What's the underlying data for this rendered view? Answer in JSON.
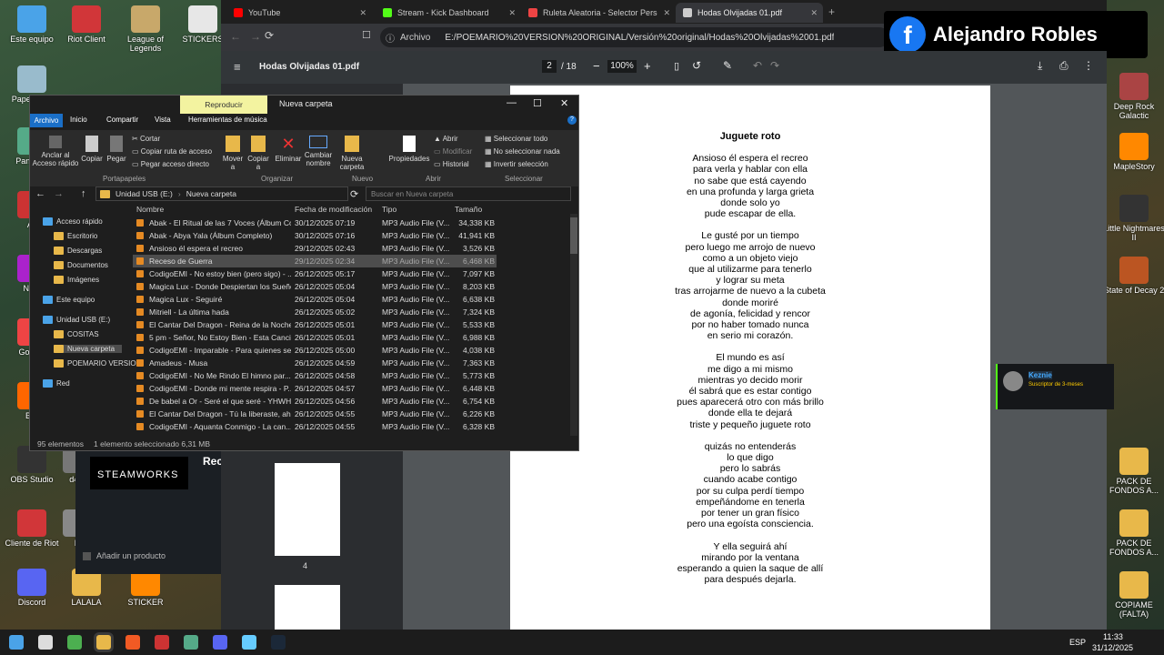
{
  "desktop": {
    "left_icons": [
      {
        "label": "Este equipo",
        "color": "#4aa3e8"
      },
      {
        "label": "Riot Client",
        "color": "#d13639"
      },
      {
        "label": "League of Legends",
        "color": "#c8a86a"
      },
      {
        "label": "STICKERS",
        "color": "#e7e7e7"
      },
      {
        "label": "Papel recic",
        "color": "#9bc"
      },
      {
        "label": "Panel de",
        "color": "#5a8"
      },
      {
        "label": "Av",
        "color": "#c33"
      },
      {
        "label": "Nitro",
        "color": "#a2c"
      },
      {
        "label": "Google",
        "color": "#e44"
      },
      {
        "label": "Bra",
        "color": "#f60"
      },
      {
        "label": "OBS Studio",
        "color": "#333"
      },
      {
        "label": "d4f0",
        "color": "#777"
      },
      {
        "label": "Cliente de Riot",
        "color": "#d13639"
      },
      {
        "label": "R",
        "color": "#888"
      },
      {
        "label": "Discord",
        "color": "#5865f2"
      },
      {
        "label": "LALALA",
        "color": "#e8b84a"
      },
      {
        "label": "STICKER",
        "color": "#f80"
      }
    ],
    "right_icons": [
      {
        "label": "Deep Rock Galactic",
        "color": "#a44"
      },
      {
        "label": "MapleStory",
        "color": "#f80"
      },
      {
        "label": "Little Nightmares II",
        "color": "#333"
      },
      {
        "label": "State of Decay 2",
        "color": "#b52"
      },
      {
        "label": "PACK DE FONDOS A...",
        "color": "#e8b84a"
      },
      {
        "label": "PACK DE FONDOS A...",
        "color": "#e8b84a"
      },
      {
        "label": "COPIAME (FALTA)",
        "color": "#e8b84a"
      }
    ],
    "overlay_name": "Alejandro Robles",
    "steamworks": "STEAMWORKS",
    "rec": "Rec",
    "add_product": "Añadir un producto",
    "chat": {
      "user": "Keznie",
      "badge": "Suscriptor de 3-meses"
    }
  },
  "browser": {
    "tabs": [
      {
        "label": "YouTube",
        "color": "#f00"
      },
      {
        "label": "Stream - Kick Dashboard",
        "color": "#53fc18"
      },
      {
        "label": "Ruleta Aleatoria - Selector Personaliz",
        "color": "#e44"
      },
      {
        "label": "Hodas Olvijadas 01.pdf",
        "color": "#ccc"
      }
    ],
    "address_prefix": "Archivo",
    "url": "E:/POEMARIO%20VERSION%20ORIGINAL/Versión%20original/Hodas%20Olvijadas%2001.pdf"
  },
  "pdf": {
    "title": "Hodas Olvijadas 01.pdf",
    "page_current": "2",
    "page_total": "/ 18",
    "zoom": "100%",
    "thumb_label": "4",
    "poem_title": "Juguete roto",
    "stanzas": [
      [
        "Ansioso él espera el recreo",
        "para verla y hablar con ella",
        "no sabe que está cayendo",
        "en una profunda y larga grieta",
        "donde solo yo",
        "pude escapar de ella."
      ],
      [
        "Le gusté por un tiempo",
        "pero luego me arrojo de nuevo",
        "como a un objeto viejo",
        "que al utilizarme para tenerlo",
        "y lograr su meta",
        "tras arrojarme de nuevo a la cubeta",
        "donde moriré",
        "de agonía, felicidad y rencor",
        "por no haber tomado nunca",
        "en serio mi corazón."
      ],
      [
        "El mundo es así",
        "me digo a mi mismo",
        "mientras yo decido morir",
        "él sabrá que es estar contigo",
        "pues aparecerá otro con más brillo",
        "donde ella te dejará",
        "triste y pequeño juguete roto"
      ],
      [
        "quizás no entenderás",
        "lo que digo",
        "pero lo sabrás",
        "cuando acabe contigo",
        "por su culpa perdí tiempo",
        "empeñándome en tenerla",
        "por tener un gran físico",
        "pero una egoísta consciencia."
      ],
      [
        "Y ella seguirá ahí",
        "mirando por la ventana",
        "esperando a quien la saque de allí",
        "para después dejarla."
      ]
    ]
  },
  "explorer": {
    "context_tab": "Reproducir",
    "window_title": "Nueva carpeta",
    "menu": [
      "Archivo",
      "Inicio",
      "Compartir",
      "Vista",
      "Herramientas de música"
    ],
    "ribbon": {
      "pin": "Anclar al Acceso rápido",
      "copy": "Copiar",
      "paste": "Pegar",
      "cut": "Cortar",
      "copy_path": "Copiar ruta de acceso",
      "paste_shortcut": "Pegar acceso directo",
      "move": "Mover a",
      "copy_to": "Copiar a",
      "delete": "Eliminar",
      "rename": "Cambiar nombre",
      "new_folder": "Nueva carpeta",
      "properties": "Propiedades",
      "open": "Abrir",
      "modify": "Modificar",
      "history": "Historial",
      "select_all": "Seleccionar todo",
      "select_none": "No seleccionar nada",
      "invert": "Invertir selección",
      "groups": [
        "Portapapeles",
        "Organizar",
        "Nuevo",
        "Abrir",
        "Seleccionar"
      ]
    },
    "path": [
      "Unidad USB (E:)",
      "Nueva carpeta"
    ],
    "search_placeholder": "Buscar en Nueva carpeta",
    "nav": [
      {
        "label": "Acceso rápido",
        "indent": 0
      },
      {
        "label": "Escritorio",
        "indent": 1
      },
      {
        "label": "Descargas",
        "indent": 1
      },
      {
        "label": "Documentos",
        "indent": 1
      },
      {
        "label": "Imágenes",
        "indent": 1
      },
      {
        "label": "Este equipo",
        "indent": 0
      },
      {
        "label": "Unidad USB (E:)",
        "indent": 0
      },
      {
        "label": "COSITAS",
        "indent": 1
      },
      {
        "label": "Nueva carpeta",
        "indent": 1
      },
      {
        "label": "POEMARIO VERSIO",
        "indent": 1
      },
      {
        "label": "Red",
        "indent": 0
      }
    ],
    "columns": [
      "Nombre",
      "Fecha de modificación",
      "Tipo",
      "Tamaño"
    ],
    "files": [
      [
        "Abak - El Ritual de las 7 Voces (Álbum Co...",
        "30/12/2025 07:19",
        "MP3 Audio File (V...",
        "34,338 KB"
      ],
      [
        "Abak - Abya Yala (Álbum Completo)",
        "30/12/2025 07:16",
        "MP3 Audio File (V...",
        "41,941 KB"
      ],
      [
        "Ansioso él espera el recreo",
        "29/12/2025 02:43",
        "MP3 Audio File (V...",
        "3,526 KB"
      ],
      [
        "Receso de Guerra",
        "29/12/2025 02:34",
        "MP3 Audio File (V...",
        "6,468 KB"
      ],
      [
        "CodigoEMI - No estoy bien (pero sigo) - ...",
        "26/12/2025 05:17",
        "MP3 Audio File (V...",
        "7,097 KB"
      ],
      [
        "Magica Lux - Donde Despiertan los Sueños",
        "26/12/2025 05:04",
        "MP3 Audio File (V...",
        "8,203 KB"
      ],
      [
        "Magica Lux - Seguiré",
        "26/12/2025 05:04",
        "MP3 Audio File (V...",
        "6,638 KB"
      ],
      [
        "Mitriell - La última hada",
        "26/12/2025 05:02",
        "MP3 Audio File (V...",
        "7,324 KB"
      ],
      [
        "El Cantar Del Dragon - Reina de la Noche...",
        "26/12/2025 05:01",
        "MP3 Audio File (V...",
        "5,533 KB"
      ],
      [
        "5 pm - Señor, No Estoy Bien - Esta Canci...",
        "26/12/2025 05:01",
        "MP3 Audio File (V...",
        "6,988 KB"
      ],
      [
        "CodigoEMI - Imparable - Para quienes se...",
        "26/12/2025 05:00",
        "MP3 Audio File (V...",
        "4,038 KB"
      ],
      [
        "Amadeus - Musa",
        "26/12/2025 04:59",
        "MP3 Audio File (V...",
        "7,363 KB"
      ],
      [
        "CodigoEMI - No Me Rindo  El himno par...",
        "26/12/2025 04:58",
        "MP3 Audio File (V...",
        "5,773 KB"
      ],
      [
        "CodigoEMI - Donde mi mente respira - P...",
        "26/12/2025 04:57",
        "MP3 Audio File (V...",
        "6,448 KB"
      ],
      [
        "De babel a Or - Seré el que seré - YHWH ...",
        "26/12/2025 04:56",
        "MP3 Audio File (V...",
        "6,754 KB"
      ],
      [
        "El Cantar Del Dragon - Tú la liberaste, ah...",
        "26/12/2025 04:55",
        "MP3 Audio File (V...",
        "6,226 KB"
      ],
      [
        "CodigoEMI - Aquanta Conmigo - La can...",
        "26/12/2025 04:55",
        "MP3 Audio File (V...",
        "6,328 KB"
      ]
    ],
    "selected_index": 3,
    "status_count": "95 elementos",
    "status_selection": "1 elemento seleccionado  6,31 MB"
  },
  "taskbar": {
    "lang": "ESP",
    "time": "11:33",
    "date": "31/12/2025",
    "apps": [
      {
        "name": "windows",
        "color": "#4aa3e8"
      },
      {
        "name": "search",
        "color": "#ddd"
      },
      {
        "name": "chrome",
        "color": "#4caf50"
      },
      {
        "name": "explorer",
        "color": "#e8b84a"
      },
      {
        "name": "brave",
        "color": "#f15a24"
      },
      {
        "name": "app-a",
        "color": "#c33"
      },
      {
        "name": "app-b",
        "color": "#5a8"
      },
      {
        "name": "discord",
        "color": "#5865f2"
      },
      {
        "name": "app-c",
        "color": "#6cf"
      },
      {
        "name": "steam",
        "color": "#1b2838"
      }
    ]
  }
}
